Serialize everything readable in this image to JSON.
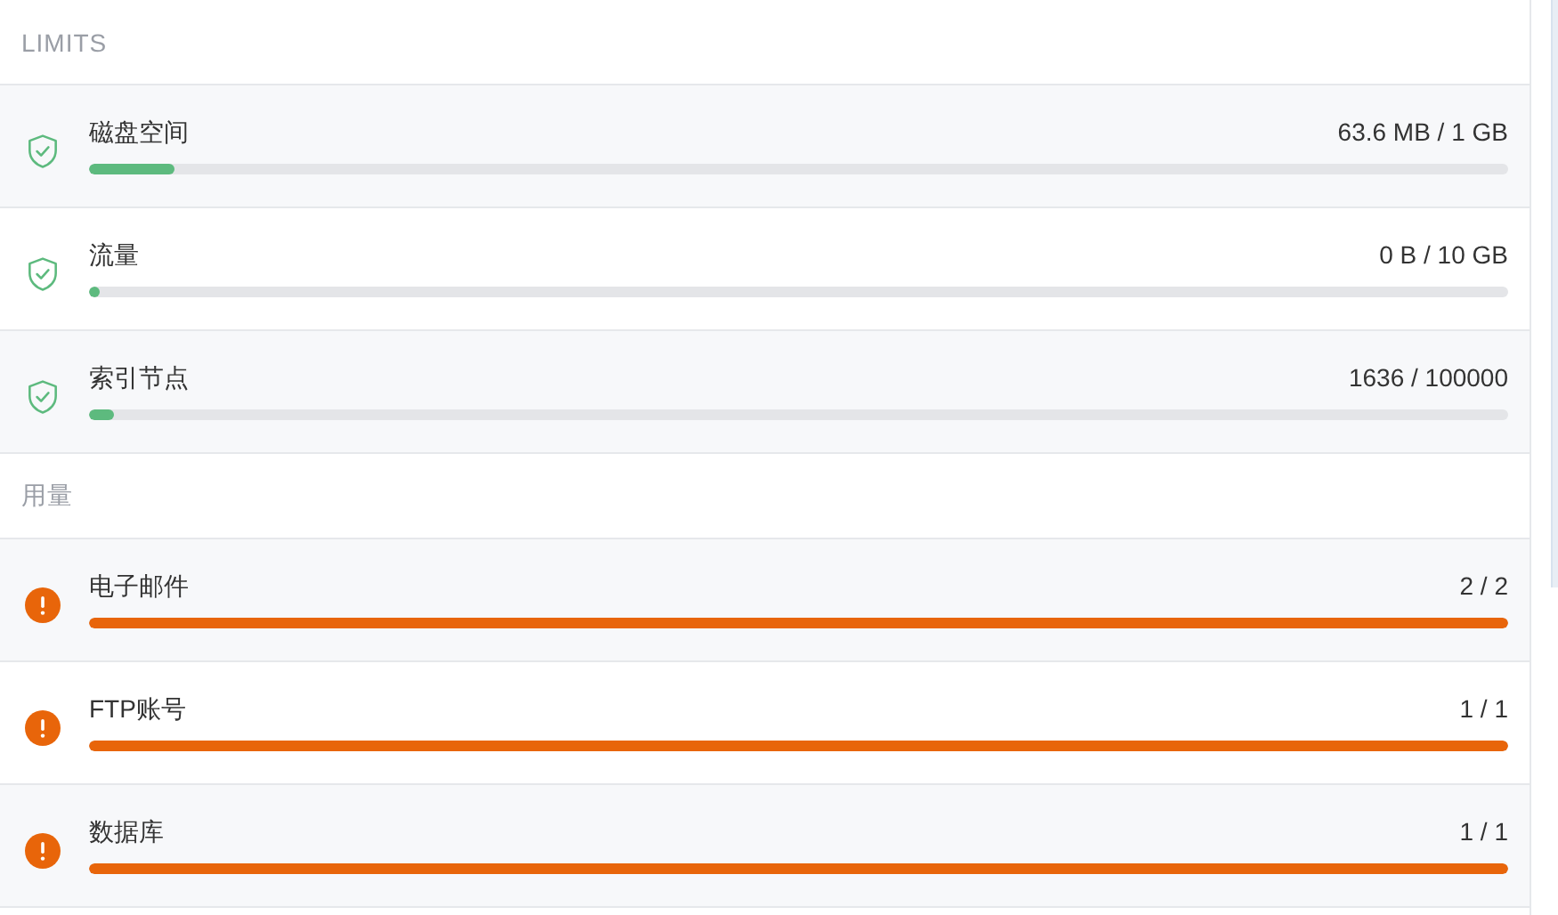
{
  "sections": [
    {
      "title": "LIMITS",
      "rows": [
        {
          "kind": "ok",
          "label": "磁盘空间",
          "reading": "63.6 MB / 1 GB",
          "level": 0.06
        },
        {
          "kind": "ok",
          "label": "流量",
          "reading": "0 B / 10 GB",
          "level": 0.008
        },
        {
          "kind": "ok",
          "label": "索引节点",
          "reading": "1636 / 100000",
          "level": 0.018
        }
      ]
    },
    {
      "title": "用量",
      "rows": [
        {
          "kind": "warning",
          "label": "电子邮件",
          "reading": "2 / 2",
          "level": 1
        },
        {
          "kind": "warning",
          "label": "FTP账号",
          "reading": "1 / 1",
          "level": 1
        },
        {
          "kind": "warning",
          "label": "数据库",
          "reading": "1 / 1",
          "level": 1
        }
      ]
    }
  ]
}
